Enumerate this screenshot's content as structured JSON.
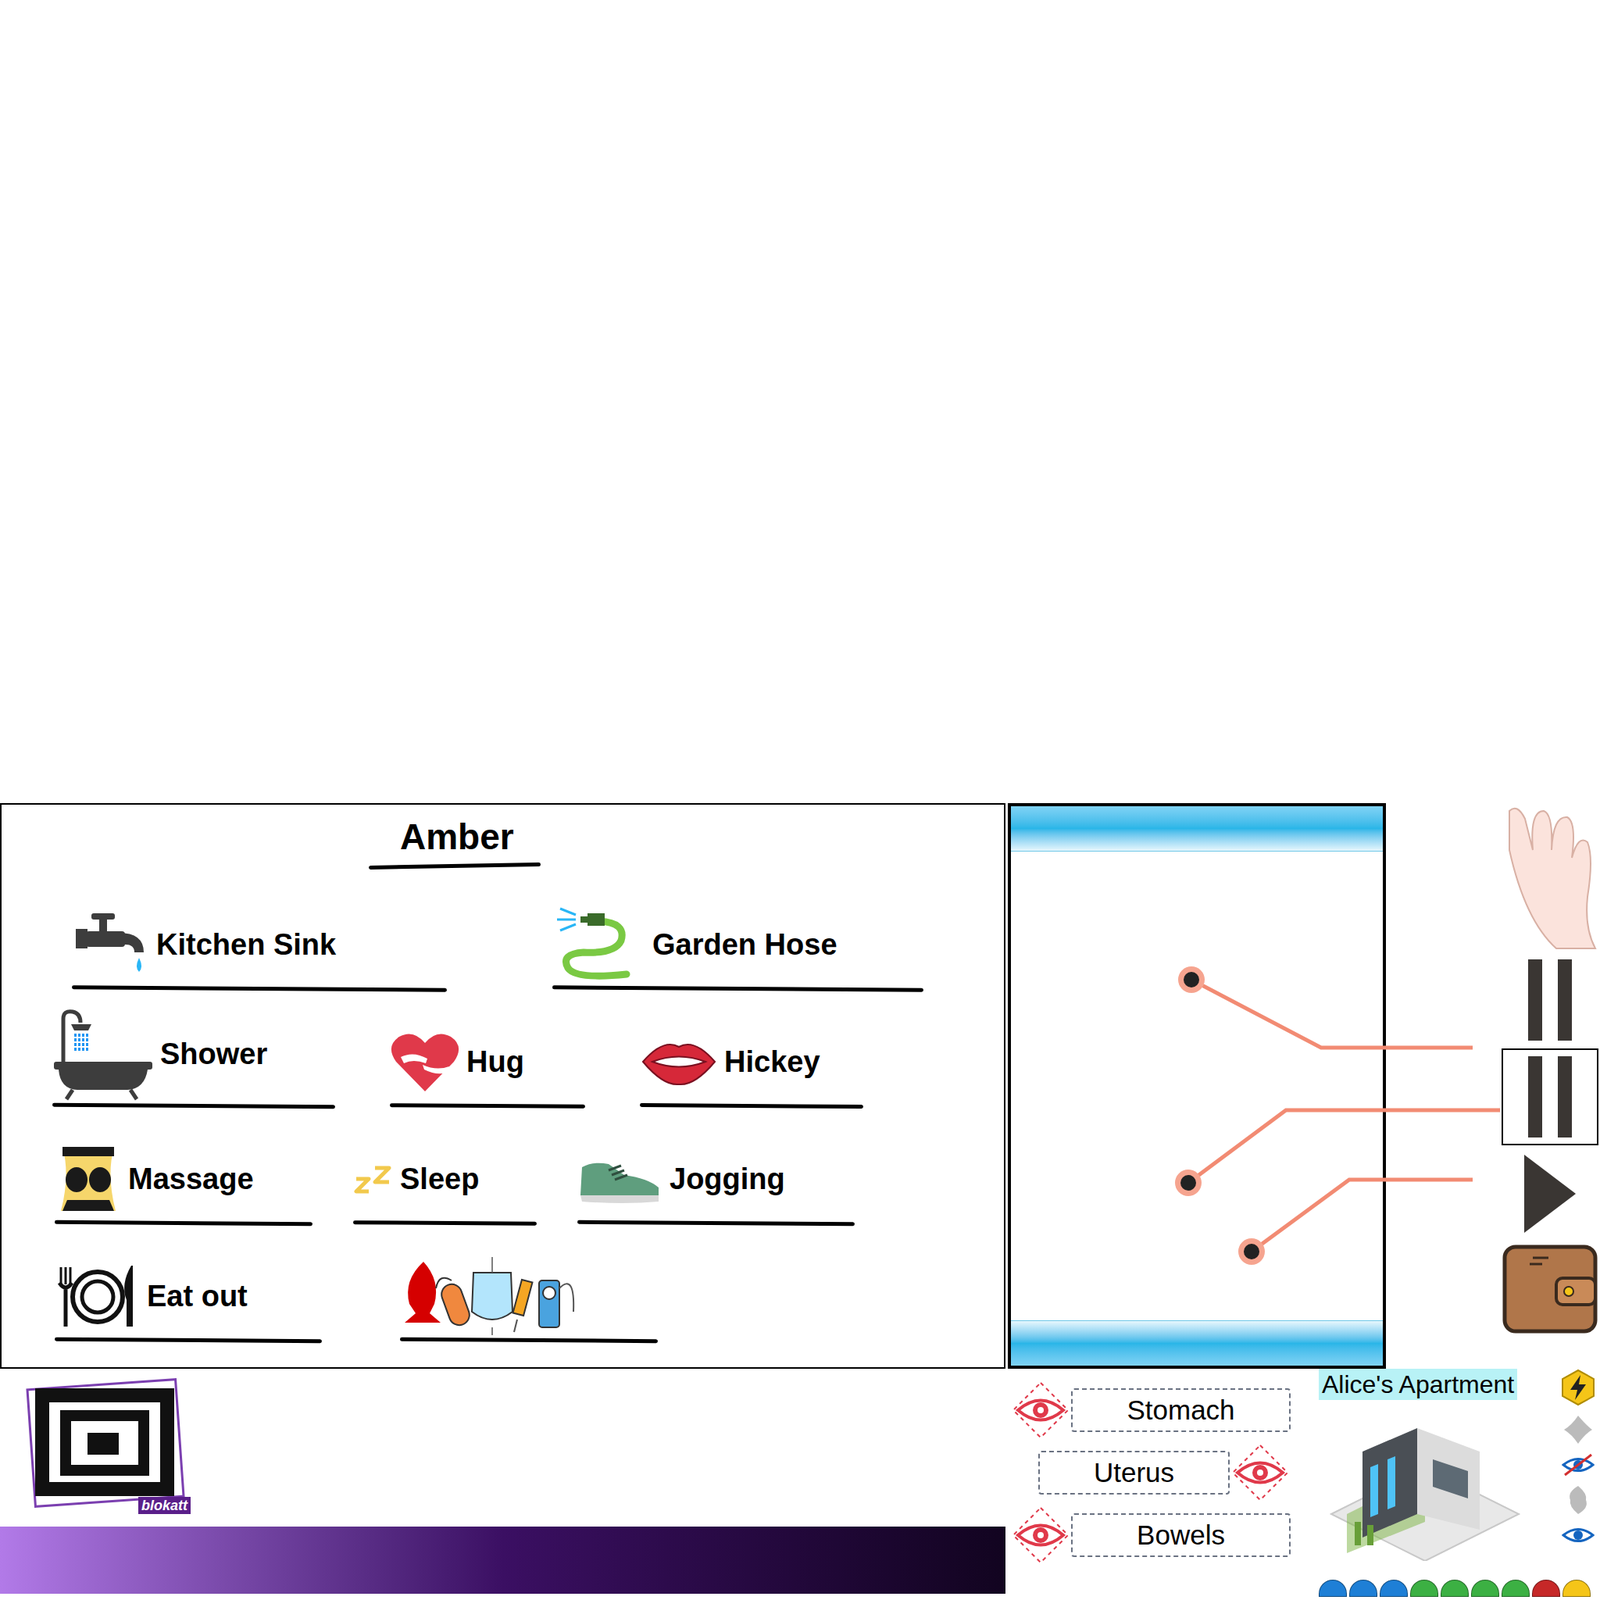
{
  "character": {
    "name": "Amber"
  },
  "activity_rows": [
    [
      {
        "label": "Kitchen Sink",
        "kind": "sink"
      },
      {
        "label": "Garden Hose",
        "kind": "hose"
      }
    ],
    [
      {
        "label": "Shower",
        "kind": "shower"
      },
      {
        "label": "Hug",
        "kind": "hug"
      },
      {
        "label": "Hickey",
        "kind": "hickey"
      }
    ],
    [
      {
        "label": "Massage",
        "kind": "massage"
      },
      {
        "label": "Sleep",
        "kind": "sleep"
      },
      {
        "label": "Jogging",
        "kind": "jogging"
      }
    ],
    [
      {
        "label": "Eat out",
        "kind": "eat-out"
      },
      {
        "label": "",
        "kind": "toys"
      }
    ]
  ],
  "time_controls": [
    {
      "kind": "pause",
      "selected": false
    },
    {
      "kind": "pause",
      "selected": true
    },
    {
      "kind": "play",
      "selected": false
    }
  ],
  "organs": [
    {
      "label": "Stomach",
      "eye_side": "left"
    },
    {
      "label": "Uterus",
      "eye_side": "right"
    },
    {
      "label": "Bowels",
      "eye_side": "left"
    }
  ],
  "location": {
    "name": "Alice's Apartment"
  },
  "logo": {
    "text": "blokatt"
  },
  "status_pills": [
    {
      "color": "#1e7fd6"
    },
    {
      "color": "#1e7fd6"
    },
    {
      "color": "#1e7fd6"
    },
    {
      "color": "#3cb043"
    },
    {
      "color": "#3cb043"
    },
    {
      "color": "#3cb043"
    },
    {
      "color": "#3cb043"
    },
    {
      "color": "#c62828"
    },
    {
      "color": "#f5c518"
    }
  ]
}
